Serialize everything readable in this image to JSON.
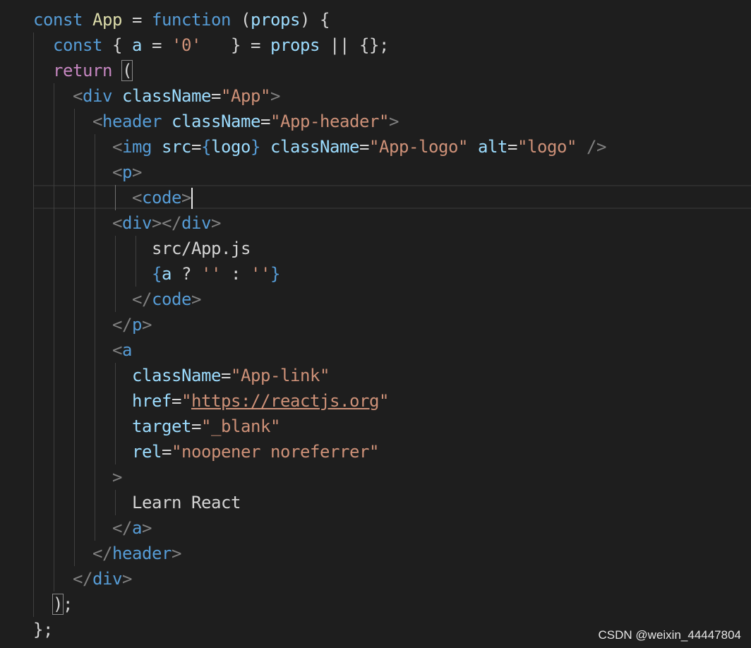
{
  "editor": {
    "language": "javascript-jsx",
    "lines": [
      "const App = function (props) {",
      "  const { a = '0'   } = props || {};",
      "  return (",
      "    <div className=\"App\">",
      "      <header className=\"App-header\">",
      "        <img src={logo} className=\"App-logo\" alt=\"logo\" />",
      "        <p>",
      "          <code>",
      "        <div></div>",
      "            src/App.js",
      "            {a ? '' : ''}",
      "          </code>",
      "        </p>",
      "        <a",
      "          className=\"App-link\"",
      "          href=\"https://reactjs.org\"",
      "          target=\"_blank\"",
      "          rel=\"noopener noreferrer\"",
      "        >",
      "          Learn React",
      "        </a>",
      "      </header>",
      "    </div>",
      "  );",
      "};"
    ]
  },
  "watermark": "CSDN @weixin_44447804",
  "colors": {
    "background": "#1e1e1e",
    "keyword": "#569cd6",
    "control_keyword": "#c586c0",
    "function_name": "#dcdcaa",
    "variable": "#9cdcfe",
    "string": "#ce9178",
    "tag_punctuation": "#808080",
    "text": "#d4d4d4"
  }
}
